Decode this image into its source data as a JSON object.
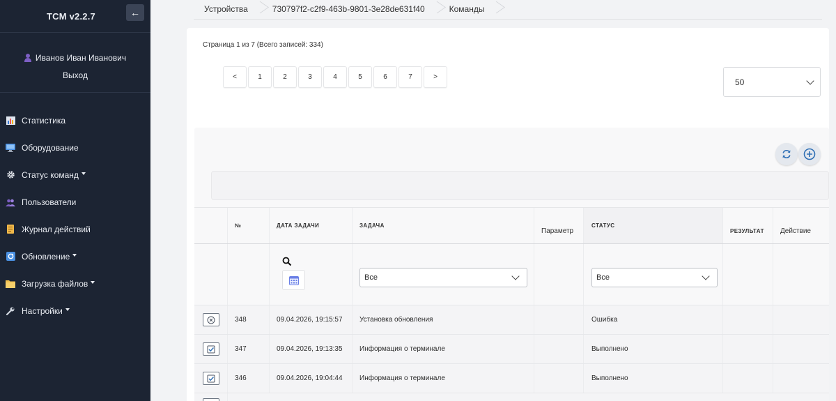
{
  "app": {
    "title": "TCM v2.2.7",
    "collapse_arrow": "←"
  },
  "user": {
    "name": "Иванов Иван Иванович",
    "logout": "Выход",
    "icon": "user-icon"
  },
  "sidebar": {
    "items": [
      {
        "label": "Статистика",
        "icon": "chart-icon",
        "dropdown": false
      },
      {
        "label": "Оборудование",
        "icon": "monitor-icon",
        "dropdown": false
      },
      {
        "label": "Статус команд",
        "icon": "gear-icon",
        "dropdown": true
      },
      {
        "label": "Пользователи",
        "icon": "users-icon",
        "dropdown": false
      },
      {
        "label": "Журнал действий",
        "icon": "journal-icon",
        "dropdown": false
      },
      {
        "label": "Обновление",
        "icon": "update-icon",
        "dropdown": true
      },
      {
        "label": "Загрузка файлов",
        "icon": "folder-icon",
        "dropdown": true
      },
      {
        "label": "Настройки",
        "icon": "wrench-icon",
        "dropdown": true
      }
    ]
  },
  "breadcrumb": [
    "Устройства",
    "730797f2-c2f9-463b-9801-3e28de631f40",
    "Команды"
  ],
  "pagination": {
    "info": "Страница 1 из 7 (Всего записей: 334)",
    "prev": "<",
    "next": ">",
    "pages": [
      "1",
      "2",
      "3",
      "4",
      "5",
      "6",
      "7"
    ],
    "page_size": "50"
  },
  "table": {
    "headers": {
      "num": "№",
      "date": "ДАТА ЗАДАЧИ",
      "task": "ЗАДАЧА",
      "param": "Параметр",
      "status": "СТАТУС",
      "result": "РЕЗУЛЬТАТ",
      "action": "Действие"
    },
    "filters": {
      "task": "Все",
      "status": "Все"
    },
    "rows": [
      {
        "icon": "cancel-circle-icon",
        "num": "348",
        "date": "09.04.2026, 19:15:57",
        "task": "Установка обновления",
        "param": "",
        "status": "Ошибка",
        "result": "",
        "action": ""
      },
      {
        "icon": "check-icon",
        "num": "347",
        "date": "09.04.2026, 19:13:35",
        "task": "Информация о терминале",
        "param": "",
        "status": "Выполнено",
        "result": "",
        "action": ""
      },
      {
        "icon": "check-icon",
        "num": "346",
        "date": "09.04.2026, 19:04:44",
        "task": "Информация о терминале",
        "param": "",
        "status": "Выполнено",
        "result": "",
        "action": ""
      }
    ]
  },
  "colors": {
    "sidebar_bg": "#1c2433",
    "accent": "#2f6fb5"
  }
}
